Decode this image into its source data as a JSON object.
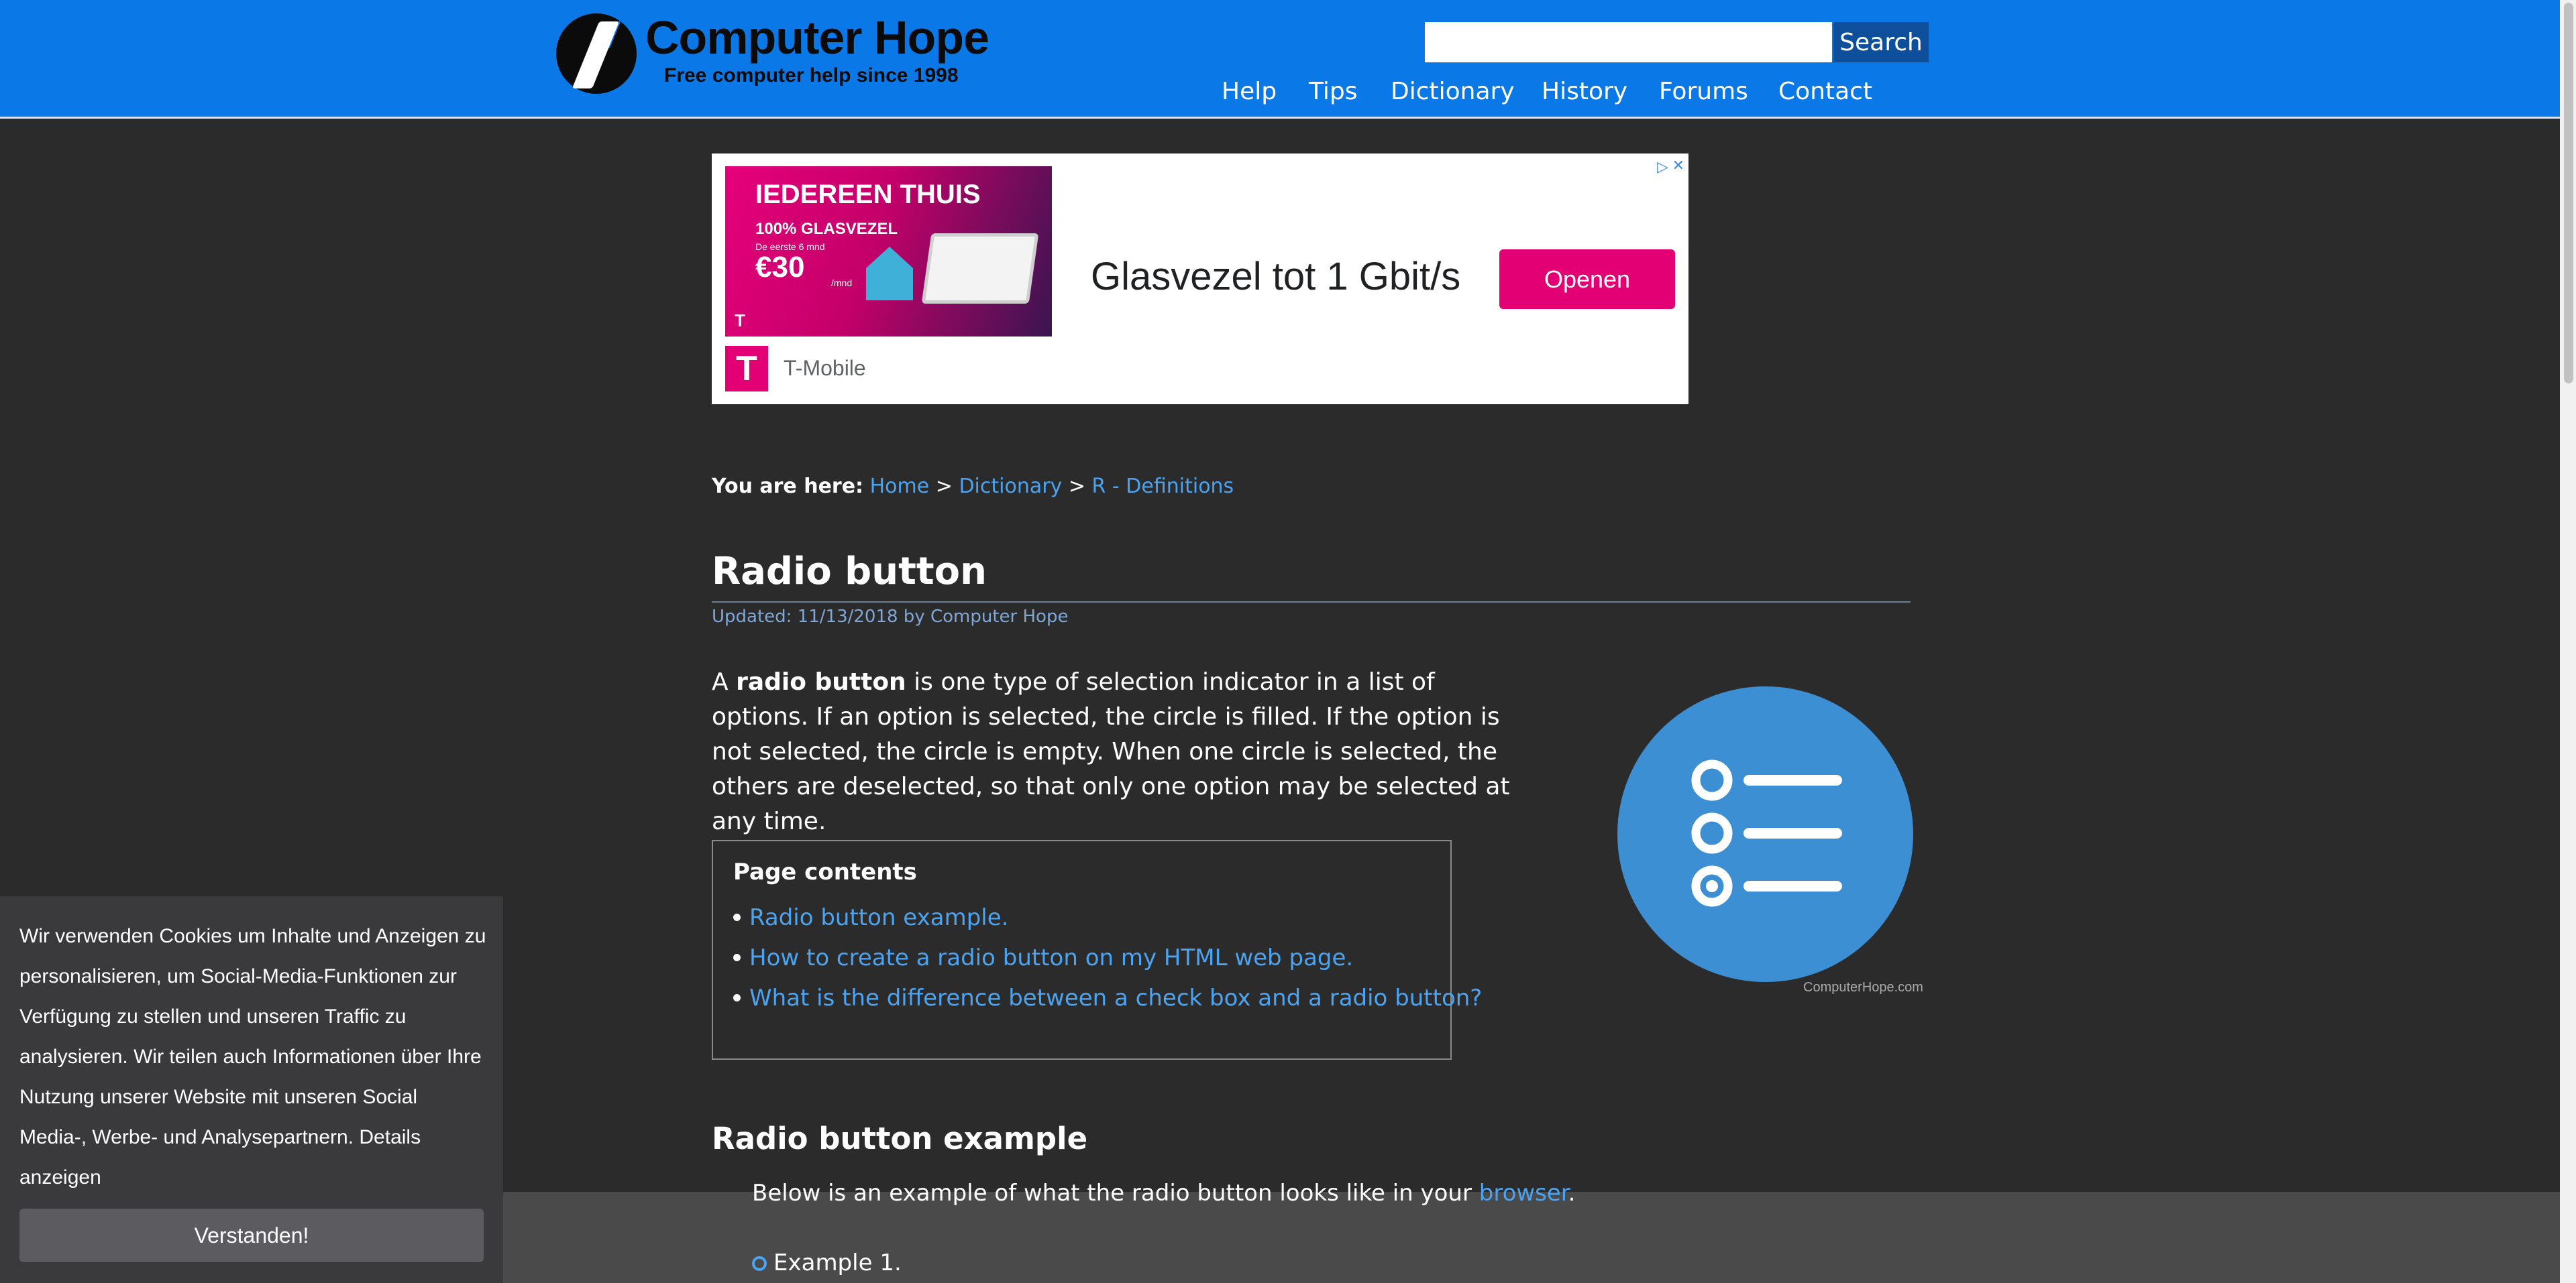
{
  "header": {
    "logo_title": "Computer Hope",
    "logo_tagline": "Free computer help since 1998",
    "search_placeholder": "",
    "search_value": "",
    "search_button": "Search",
    "nav": [
      "Help",
      "Tips",
      "Dictionary",
      "History",
      "Forums",
      "Contact"
    ]
  },
  "ad": {
    "banner_title": "IEDEREEN THUIS",
    "banner_sub": "100% GLASVEZEL",
    "banner_small": "De eerste 6 mnd",
    "banner_price": "€30",
    "banner_unit": "/mnd",
    "headline": "Glasvezel tot 1 Gbit/s",
    "button": "Openen",
    "brand": "T-Mobile",
    "brand_logo": "T"
  },
  "breadcrumb": {
    "label": "You are here:",
    "items": [
      "Home",
      "Dictionary",
      "R - Definitions"
    ],
    "separator": ">"
  },
  "article": {
    "title": "Radio button",
    "updated": "Updated: 11/13/2018 by Computer Hope",
    "intro_a": "A ",
    "intro_bold": "radio button",
    "intro_b": " is one type of selection indicator in a list of options. If an option is selected, the circle is filled. If the option is not selected, the circle is empty. When one circle is selected, the others are deselected, so that only one option may be selected at any time.",
    "contents_heading": "Page contents",
    "contents": [
      "Radio button example.",
      "How to create a radio button on my HTML web page.",
      "What is the difference between a check box and a radio button?"
    ],
    "illustration_credit": "ComputerHope.com",
    "section_heading": "Radio button example",
    "below_text": "Below is an example of what the radio button looks like in your ",
    "below_link": "browser",
    "below_end": ".",
    "example_label": "Example 1."
  },
  "cookie": {
    "text": "Wir verwenden Cookies um Inhalte und Anzeigen zu personalisieren, um Social-Media-Funktionen zur Verfügung zu stellen und unseren Traffic zu analysieren. Wir teilen auch Informationen über Ihre Nutzung unserer Website mit unseren Social Media-, Werbe- und Analysepartnern. ",
    "link": "Details anzeigen",
    "button": "Verstanden!"
  },
  "colors": {
    "header_blue": "#0a78e6",
    "link_blue": "#4ba4f2",
    "page_bg": "#2b2b2b",
    "ad_magenta": "#e20074"
  }
}
